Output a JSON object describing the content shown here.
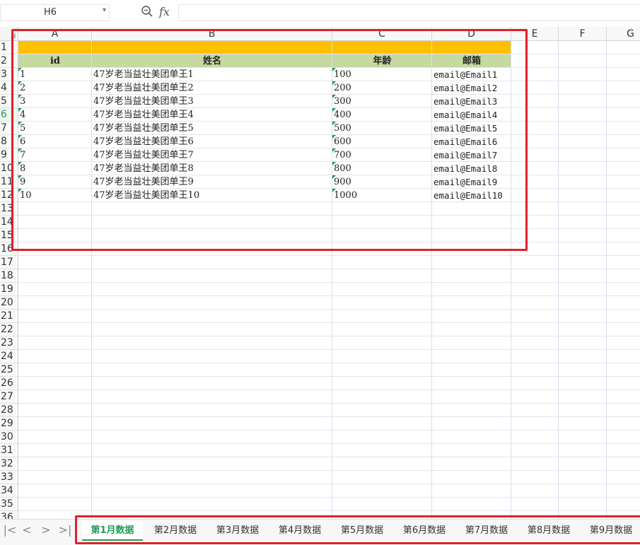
{
  "formula_bar": {
    "cell_ref": "H6",
    "fx_label": "fx",
    "formula_value": ""
  },
  "columns": [
    "A",
    "B",
    "C",
    "D",
    "E",
    "F",
    "G"
  ],
  "rows": [
    "1",
    "2",
    "3",
    "4",
    "5",
    "6",
    "7",
    "8",
    "9",
    "10",
    "11",
    "12",
    "13",
    "14",
    "15",
    "16",
    "17",
    "18",
    "19",
    "20",
    "21",
    "22",
    "23",
    "24",
    "25",
    "26",
    "27",
    "28",
    "29",
    "30",
    "31",
    "32",
    "33",
    "34",
    "35",
    "36"
  ],
  "active_row": "6",
  "table": {
    "headers": [
      "id",
      "姓名",
      "年龄",
      "邮箱"
    ],
    "rows": [
      [
        "1",
        "47岁老当益壮美团单王1",
        "100",
        "email@Email1"
      ],
      [
        "2",
        "47岁老当益壮美团单王2",
        "200",
        "email@Email2"
      ],
      [
        "3",
        "47岁老当益壮美团单王3",
        "300",
        "email@Email3"
      ],
      [
        "4",
        "47岁老当益壮美团单王4",
        "400",
        "email@Email4"
      ],
      [
        "5",
        "47岁老当益壮美团单王5",
        "500",
        "email@Email5"
      ],
      [
        "6",
        "47岁老当益壮美团单王6",
        "600",
        "email@Email6"
      ],
      [
        "7",
        "47岁老当益壮美团单王7",
        "700",
        "email@Email7"
      ],
      [
        "8",
        "47岁老当益壮美团单王8",
        "800",
        "email@Email8"
      ],
      [
        "9",
        "47岁老当益壮美团单王9",
        "900",
        "email@Email9"
      ],
      [
        "10",
        "47岁老当益壮美团单王10",
        "1000",
        "email@Email10"
      ]
    ]
  },
  "colors": {
    "banner": "#ffc000",
    "header_fill": "#c5d9a0",
    "highlight_border": "#e0202a",
    "active_tab": "#1e9a5a"
  },
  "sheet_nav": {
    "first": "|<",
    "prev": "<",
    "next": ">",
    "last": ">|"
  },
  "sheet_tabs": [
    "第1月数据",
    "第2月数据",
    "第3月数据",
    "第4月数据",
    "第5月数据",
    "第6月数据",
    "第7月数据",
    "第8月数据",
    "第9月数据"
  ],
  "active_tab": "第1月数据"
}
